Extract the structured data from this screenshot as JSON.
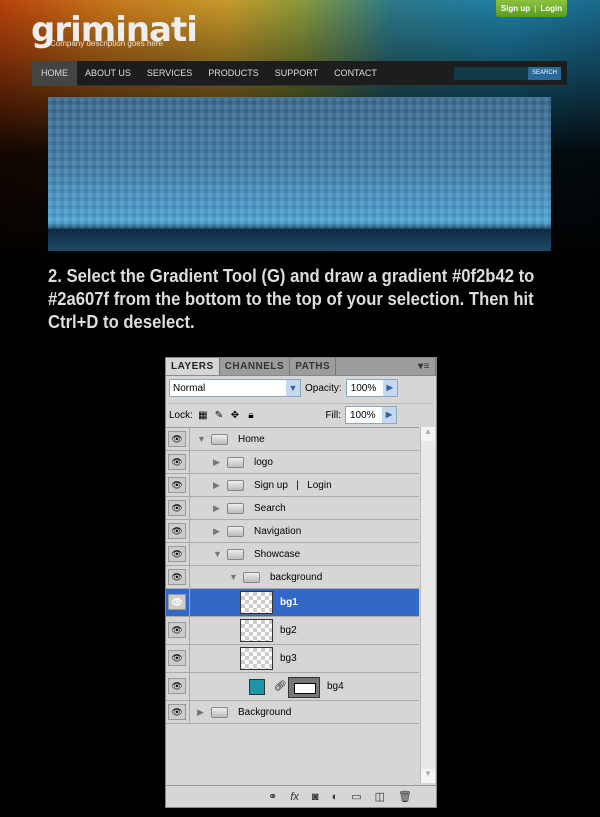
{
  "site": {
    "logo": "griminati",
    "tagline": "Company description goes here",
    "signup": "Sign up",
    "login": "Login",
    "auth_sep": "|",
    "nav": [
      "HOME",
      "ABOUT US",
      "SERVICES",
      "PRODUCTS",
      "SUPPORT",
      "CONTACT"
    ],
    "search_button": "SEARCH"
  },
  "instruction": "2. Select the Gradient Tool (G) and draw a gradient #0f2b42 to #2a607f from the bottom to the top of your selection. Then hit Ctrl+D to deselect.",
  "panel": {
    "tabs": [
      "LAYERS",
      "CHANNELS",
      "PATHS"
    ],
    "blend_mode": "Normal",
    "opacity_label": "Opacity:",
    "opacity": "100%",
    "lock_label": "Lock:",
    "fill_label": "Fill:",
    "fill": "100%",
    "layers": [
      {
        "name": "Home",
        "type": "group",
        "expanded": true
      },
      {
        "name": "logo",
        "type": "group",
        "expanded": false
      },
      {
        "name": "Sign up   |   Login",
        "type": "group",
        "expanded": false
      },
      {
        "name": "Search",
        "type": "group",
        "expanded": false
      },
      {
        "name": "Navigation",
        "type": "group",
        "expanded": false
      },
      {
        "name": "Showcase",
        "type": "group",
        "expanded": true
      },
      {
        "name": "background",
        "type": "group",
        "expanded": true
      },
      {
        "name": "bg1",
        "type": "layer",
        "selected": true
      },
      {
        "name": "bg2",
        "type": "layer"
      },
      {
        "name": "bg3",
        "type": "layer"
      },
      {
        "name": "bg4",
        "type": "fill-layer",
        "color": "#1e96a8"
      },
      {
        "name": "Background",
        "type": "group",
        "expanded": false
      }
    ]
  },
  "colors": {
    "selection": "#3468c8",
    "gradient_start": "#0f2b42",
    "gradient_end": "#2a607f"
  }
}
